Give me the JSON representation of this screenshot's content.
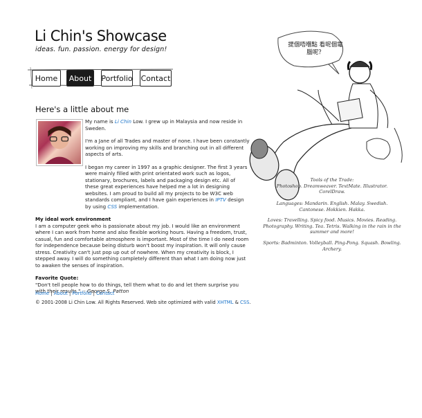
{
  "header": {
    "title": "Li Chin's Showcase",
    "tagline": "ideas. fun. passion. energy for design!"
  },
  "nav": {
    "home": "Home",
    "about": "About",
    "portfolio": "Portfolio",
    "contact": "Contact",
    "active": "About"
  },
  "main": {
    "heading": "Here's a little about me",
    "intro_before": "My name is ",
    "intro_name_link": "Li Chin",
    "intro_after": " Low. I grew up in Malaysia and now reside in Sweden.",
    "para2": "I'm a Jane of all Trades and master of none. I have been constantly working on improving my skills and branching out in all different aspects of arts.",
    "para3_before": "I began my career in 1997 as a graphic designer. The first 3 years were mainly filled with print orientated work such as logos, stationary, brochures, labels and packaging design etc. All of these great experiences have helped me a lot in designing websites. I am proud to build all my projects to be W3C web standards compliant, and I have gain experiences in ",
    "para3_link1": "IPTV",
    "para3_mid": " design by using ",
    "para3_link2": "CSS",
    "para3_after": " implementation.",
    "ideal_heading": "My ideal work environment",
    "ideal_text": "I am a computer geek who is passionate about my job. I would like an environment where I can work from home and also flexible working hours. Having a freedom, trust, casual, fun and comfortable atmosphere is important. Most of the time I do need room for independence because being disturb won't boost my inspiration. It will only cause stress. Creativity can't just pop up out of nowhere. When my creativity is block, I stepped away. I will do something completely different than what I am doing now just to awaken the senses of inspiration.",
    "quote_heading": "Favorite Quote:",
    "quote_text": "\"Don't tell people how to do things, tell them what to do and let them surprise you with their results.\" -- ",
    "quote_author": "George S. Patton"
  },
  "footer": {
    "links": [
      "Home",
      "About",
      "Portfolio",
      "Contact"
    ],
    "sep": " | ",
    "copyright_before": "© 2001-2008 Li Chin Low. All Rights Reserved. Web site optimized with valid ",
    "xhtml": "XHTML",
    "amp": " & ",
    "css": "CSS",
    "period": "."
  },
  "illustration": {
    "speech_bubble": "提個唔嗰點 看呢個電腦呢？",
    "tools_heading": "Tools of the Trade:",
    "tools": "Photoshop. Dreamweaver. TextMate. Illustrator. CorelDraw.",
    "languages": "Languages: Mandarin. English. Malay. Swedish. Cantonese. Hokkien. Hakka.",
    "loves": "Loves: Travelling. Spicy food. Musics. Movies. Reading. Photography. Writing. Tea. Tetris. Walking in the rain in the summer and more!",
    "sports": "Sports: Badminton. Volleyball. Ping-Pong. Squash. Bowling. Archery."
  }
}
